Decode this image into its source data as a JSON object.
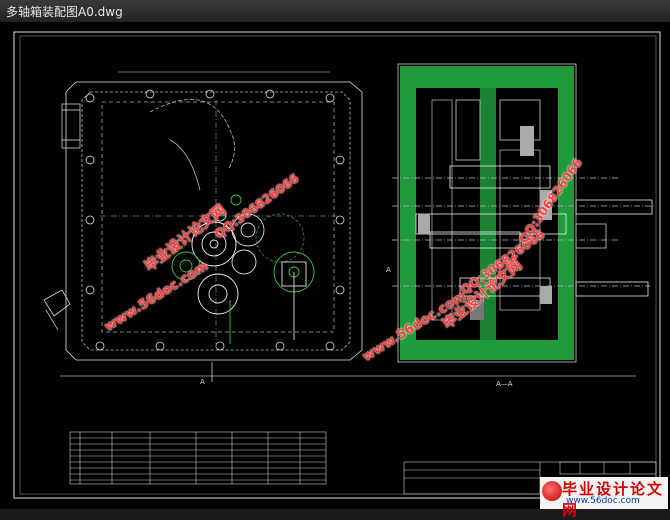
{
  "window": {
    "title": "多轴箱装配图A0.dwg"
  },
  "drawing": {
    "section_label": "A—A",
    "view_marker_left": "A",
    "view_marker_right": "A"
  },
  "watermarks": {
    "site_cn": "毕业设计论文网",
    "site_url": "www.56doc.com",
    "qq": "QQ:306826066"
  },
  "footer_banner": {
    "cn": "毕业设计论文网",
    "url": "www.56doc.com"
  },
  "colors": {
    "background": "#000000",
    "frame": "#ffffff",
    "green_section": "#1f9a3a",
    "watermark_red": "#ff3b3b"
  }
}
